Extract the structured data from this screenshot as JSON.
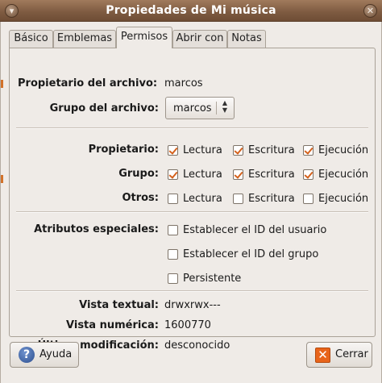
{
  "window": {
    "title": "Propiedades de Mi música",
    "menu_icon": "window-menu-icon",
    "close_icon": "window-close-icon"
  },
  "tabs": [
    {
      "label": "Básico",
      "active": false
    },
    {
      "label": "Emblemas",
      "active": false
    },
    {
      "label": "Permisos",
      "active": true
    },
    {
      "label": "Abrir con",
      "active": false
    },
    {
      "label": "Notas",
      "active": false
    }
  ],
  "owner": {
    "label": "Propietario del archivo:",
    "value": "marcos"
  },
  "group": {
    "label": "Grupo del archivo:",
    "selected": "marcos"
  },
  "permissions": {
    "owner_label": "Propietario:",
    "group_label": "Grupo:",
    "others_label": "Otros:",
    "read_label": "Lectura",
    "write_label": "Escritura",
    "exec_label": "Ejecución",
    "owner": {
      "read": true,
      "write": true,
      "exec": true
    },
    "group": {
      "read": true,
      "write": true,
      "exec": true
    },
    "others": {
      "read": false,
      "write": false,
      "exec": false
    }
  },
  "special": {
    "label": "Atributos especiales:",
    "setuid": {
      "label": "Establecer el ID del usuario",
      "checked": false
    },
    "setgid": {
      "label": "Establecer el ID del grupo",
      "checked": false
    },
    "sticky": {
      "label": "Persistente",
      "checked": false
    }
  },
  "info": {
    "text_view_label": "Vista textual:",
    "text_view_value": "drwxrwx---",
    "numeric_view_label": "Vista numérica:",
    "numeric_view_value": "1600770",
    "modified_label": "Última modificación:",
    "modified_value": "desconocido"
  },
  "buttons": {
    "help_label": "Ayuda",
    "help_icon": "help-icon",
    "close_label": "Cerrar",
    "close_icon": "close-icon"
  },
  "colors": {
    "titlebar": "#7d5a40",
    "checkmark": "#d4611c",
    "window_bg": "#efebe7"
  }
}
